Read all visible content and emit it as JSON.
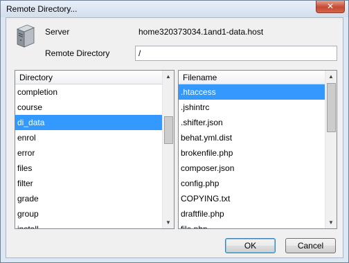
{
  "window": {
    "title": "Remote Directory...",
    "close_glyph": "✕"
  },
  "server": {
    "label": "Server",
    "value": "home320373034.1and1-data.host",
    "icon": "server-icon"
  },
  "remote_dir": {
    "label": "Remote Directory",
    "value": "/"
  },
  "directory_list": {
    "header": "Directory",
    "selected": "di_data",
    "items": [
      "completion",
      "course",
      "di_data",
      "enrol",
      "error",
      "files",
      "filter",
      "grade",
      "group",
      "install"
    ]
  },
  "file_list": {
    "header": "Filename",
    "selected": ".htaccess",
    "items": [
      ".htaccess",
      ".jshintrc",
      ".shifter.json",
      "behat.yml.dist",
      "brokenfile.php",
      "composer.json",
      "config.php",
      "COPYING.txt",
      "draftfile.php",
      "file.php"
    ]
  },
  "buttons": {
    "ok": "OK",
    "cancel": "Cancel"
  },
  "colors": {
    "selection": "#3399ff",
    "window_border": "#6f7f93"
  }
}
